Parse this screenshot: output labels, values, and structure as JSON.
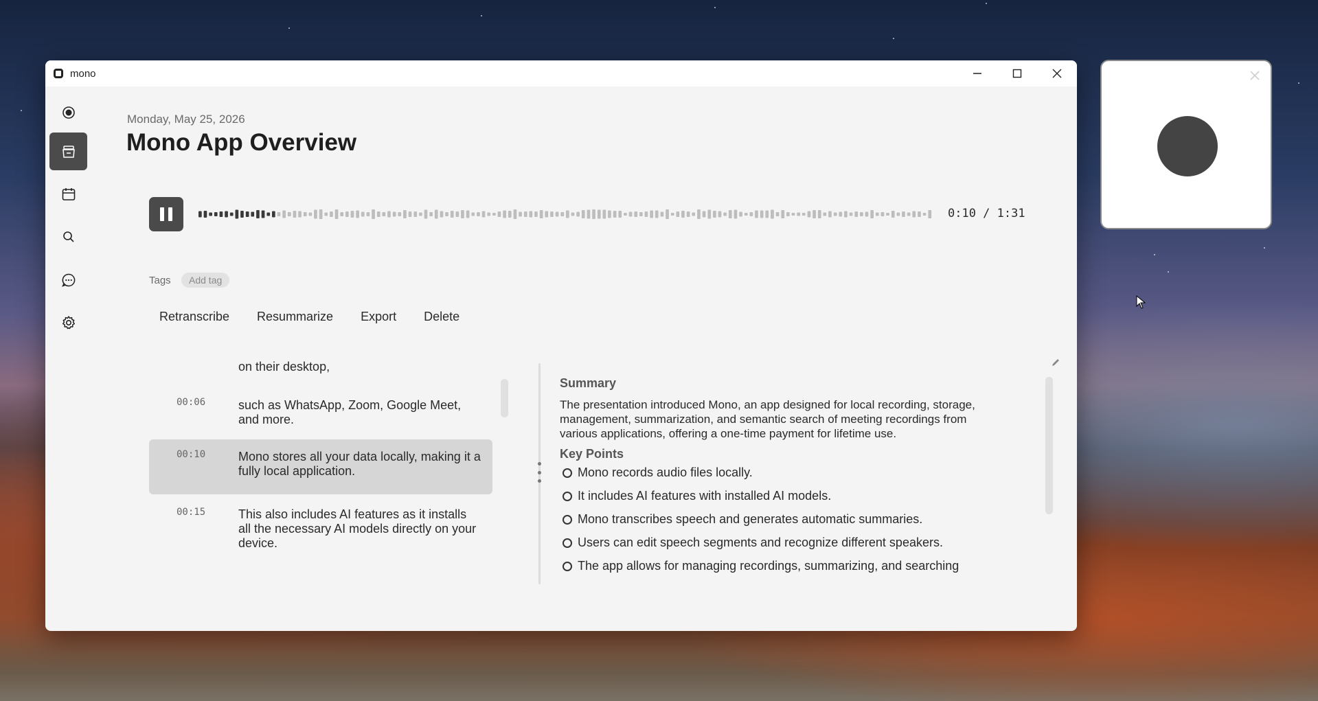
{
  "window": {
    "app_name": "mono",
    "controls": [
      "minimize-icon",
      "maximize-icon",
      "close-icon"
    ]
  },
  "sidebar": {
    "items": [
      {
        "icon": "record-icon",
        "active": false
      },
      {
        "icon": "library-icon",
        "active": true
      },
      {
        "icon": "calendar-icon",
        "active": false
      },
      {
        "icon": "search-icon",
        "active": false
      },
      {
        "icon": "chat-icon",
        "active": false
      },
      {
        "icon": "gear-icon",
        "active": false
      }
    ]
  },
  "header": {
    "date": "Monday, May 25, 2026",
    "title": "Mono App Overview"
  },
  "player": {
    "state_icon": "pause-icon",
    "time": "0:10 / 1:31",
    "progress": 0.11
  },
  "tags": {
    "label": "Tags",
    "add_tag": "Add tag"
  },
  "actions": {
    "retranscribe": "Retranscribe",
    "resummarize": "Resummarize",
    "export": "Export",
    "delete": "Delete"
  },
  "transcript": {
    "segments": [
      {
        "time": "",
        "text": "on their desktop,"
      },
      {
        "time": "00:06",
        "text": "such as WhatsApp, Zoom, Google Meet, and more."
      },
      {
        "time": "00:10",
        "text": "Mono stores all your data locally, making it a fully local application.",
        "active": true
      },
      {
        "time": "00:15",
        "text": "This also includes AI features as it installs all the necessary AI models directly on your device."
      }
    ]
  },
  "summary": {
    "heading": "Summary",
    "text": "The presentation introduced Mono, an app designed for local recording, storage, management, summarization, and semantic search of meeting recordings from various applications, offering a one-time payment for lifetime use.",
    "key_points_heading": "Key Points",
    "key_points": [
      "Mono records audio files locally.",
      "It includes AI features with installed AI models.",
      "Mono transcribes speech and generates automatic summaries.",
      "Users can edit speech segments and recognize different speakers.",
      "The app allows for managing recordings, summarizing, and searching"
    ]
  },
  "colors": {
    "accent": "#4a4a4a",
    "highlight": "#d6d6d6",
    "wave_played": "#3a3a3a",
    "wave_unplayed": "#bdbdbd"
  }
}
